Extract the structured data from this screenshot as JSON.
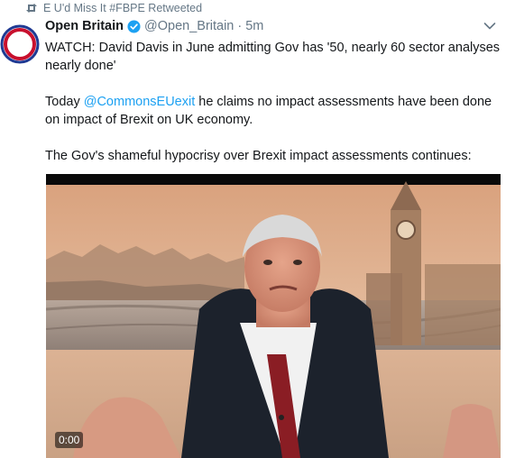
{
  "retweet": {
    "icon": "retweet-icon",
    "text": "E U'd Miss It #FBPE Retweeted"
  },
  "tweet": {
    "display_name": "Open Britain",
    "handle": "@Open_Britain",
    "separator": "·",
    "time": "5m",
    "verified": true,
    "paragraph1": "WATCH: David Davis in June admitting Gov has '50, nearly 60 sector analyses nearly done'",
    "paragraph2_prefix": "Today ",
    "paragraph2_mention": "@CommonsEUexit",
    "paragraph2_suffix": " he claims no impact assessments have been done on impact of Brexit on UK economy.",
    "paragraph3": "The Gov's shameful hypocrisy over Brexit impact assessments continues:"
  },
  "video": {
    "timestamp": "0:00"
  },
  "colors": {
    "link": "#1da1f2",
    "muted": "#657786",
    "verified": "#1da1f2",
    "avatar_red": "#c8102e",
    "avatar_blue": "#1f3a93"
  }
}
